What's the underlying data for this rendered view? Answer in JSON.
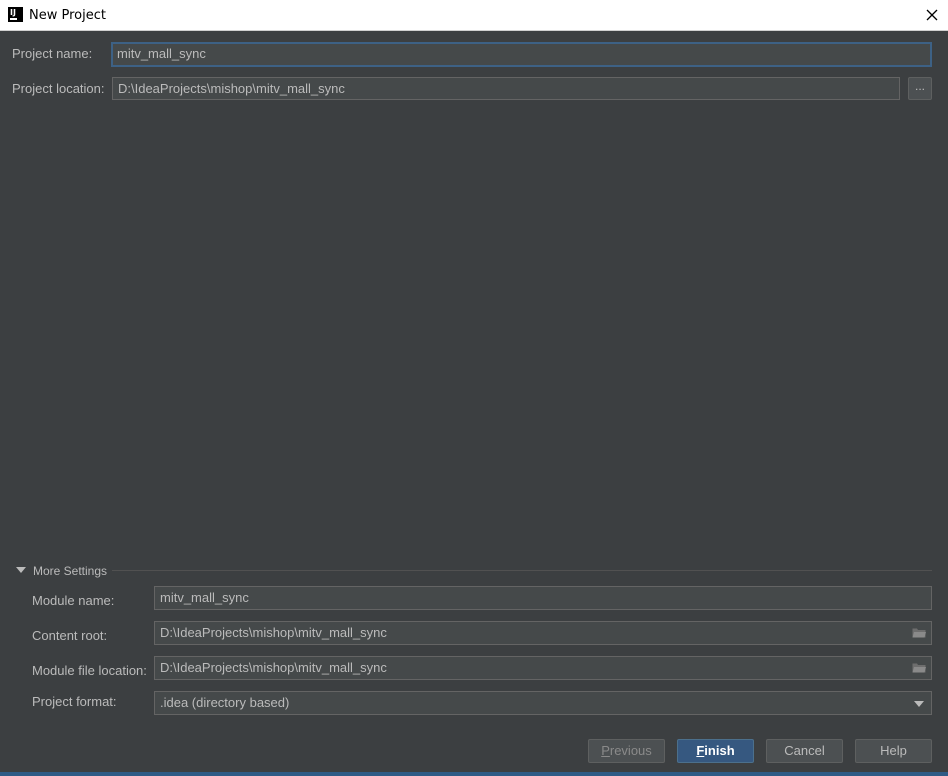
{
  "window": {
    "title": "New Project",
    "app_icon": "intellij-idea-icon",
    "close_icon": "close-icon"
  },
  "project": {
    "name_label": "Project name:",
    "name_value": "mitv_mall_sync",
    "location_label": "Project location:",
    "location_value": "D:\\IdeaProjects\\mishop\\mitv_mall_sync",
    "browse_label": "..."
  },
  "more_settings": {
    "label": "More Settings",
    "module_name_label": "Module name:",
    "module_name_value": "mitv_mall_sync",
    "content_root_label": "Content root:",
    "content_root_value": "D:\\IdeaProjects\\mishop\\mitv_mall_sync",
    "module_file_label": "Module file location:",
    "module_file_value": "D:\\IdeaProjects\\mishop\\mitv_mall_sync",
    "format_label": "Project format:",
    "format_value": ".idea (directory based)"
  },
  "buttons": {
    "previous_first": "P",
    "previous_rest": "revious",
    "finish_first": "F",
    "finish_rest": "inish",
    "cancel": "Cancel",
    "help": "Help"
  },
  "colors": {
    "background": "#3c3f41",
    "field": "#45494a",
    "focus": "#3d6185",
    "primary": "#365880",
    "text": "#bbbbbb"
  }
}
